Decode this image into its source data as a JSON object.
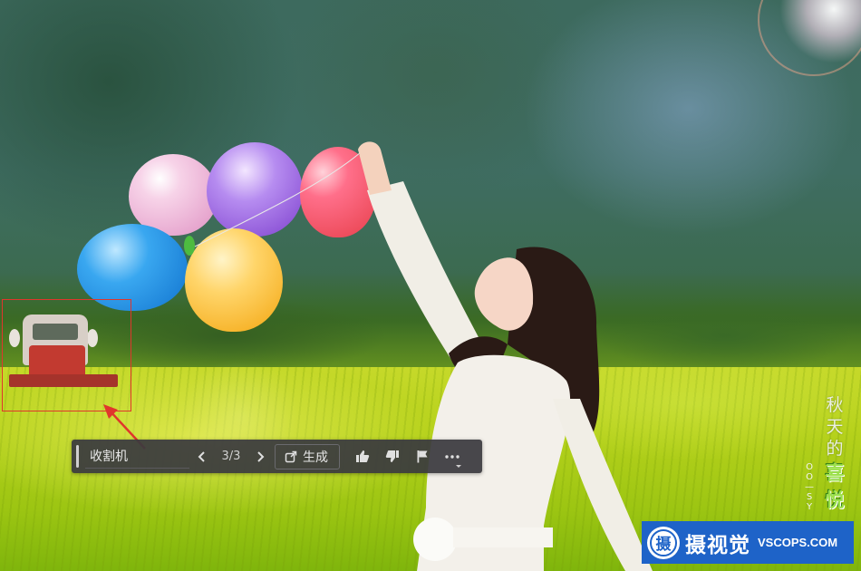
{
  "toolbar": {
    "query": "收割机",
    "counter": "3/3",
    "generate_label": "生成"
  },
  "photo_text": {
    "vertical_chars": [
      "秋",
      "天",
      "的"
    ],
    "vertical_accent_chars": [
      "喜",
      "悦"
    ],
    "vertical_small": [
      "O",
      "O",
      "—",
      "S",
      "Y"
    ]
  },
  "watermark": {
    "logo_glyph": "摄",
    "brand_cn": "摄视觉",
    "brand_en": "VSCOPS.COM"
  },
  "annotation": {
    "color": "#e0362c"
  },
  "colors": {
    "toolbar_bg": "#3a3a3e",
    "logo_bg": "#1e63c8",
    "accent_green": "#9be04a"
  },
  "icons": [
    "chevron-left-icon",
    "chevron-right-icon",
    "share-generate-icon",
    "thumbs-up-icon",
    "thumbs-down-icon",
    "flag-icon",
    "more-icon"
  ]
}
